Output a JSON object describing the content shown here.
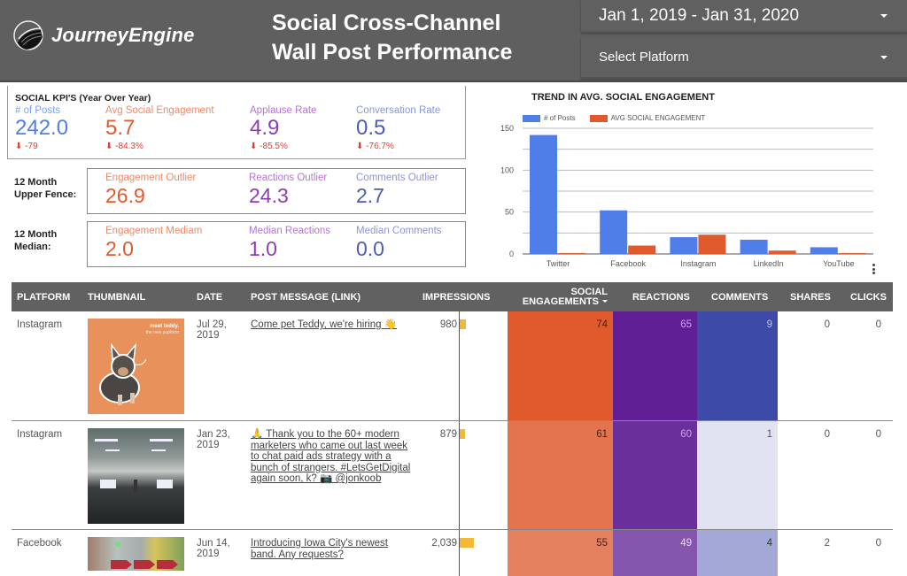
{
  "header": {
    "logo_text": "JourneyEngine",
    "title_line1": "Social Cross-Channel",
    "title_line2": "Wall Post Performance",
    "date_range": "Jan 1, 2019 - Jan 31, 2020",
    "platform_select": "Select Platform"
  },
  "kpis": {
    "heading": "SOCIAL KPI'S (Year Over Year)",
    "items": [
      {
        "label": "# of Posts",
        "value": "242.0",
        "delta": "-79"
      },
      {
        "label": "Avg Social Engagement",
        "value": "5.7",
        "delta": "-84.3%"
      },
      {
        "label": "Applause Rate",
        "value": "4.9",
        "delta": "-85.5%"
      },
      {
        "label": "Conversation Rate",
        "value": "0.5",
        "delta": "-76.7%"
      }
    ],
    "delta_icon": "arrow-down-icon"
  },
  "upper_fence": {
    "label_line1": "12 Month",
    "label_line2": "Upper Fence:",
    "items": [
      {
        "label": "Engagement Outlier",
        "value": "26.9"
      },
      {
        "label": "Reactions Outlier",
        "value": "24.3"
      },
      {
        "label": "Comments Outlier",
        "value": "2.7"
      }
    ]
  },
  "median": {
    "label_line1": "12 Month",
    "label_line2": "Median:",
    "items": [
      {
        "label": "Engagement Mediam",
        "value": "2.0"
      },
      {
        "label": "Median Reactions",
        "value": "1.0"
      },
      {
        "label": "Median Comments",
        "value": "0.0"
      }
    ]
  },
  "colors": {
    "posts_blue": "#4f7ee8",
    "engagement_orange": "#e05a2e",
    "header_gray": "#5f5f5f",
    "impressions_bar": "#f4b836"
  },
  "chart_data": {
    "type": "bar",
    "title": "TREND IN AVG. SOCIAL ENGAGEMENT",
    "categories": [
      "Twitter",
      "Facebook",
      "Instagram",
      "LinkedIn",
      "YouTube"
    ],
    "series": [
      {
        "name": "# of Posts",
        "color": "#4f7ee8",
        "values": [
          142,
          52,
          20,
          17,
          8
        ]
      },
      {
        "name": "AVG SOCIAL ENGAGEMENT",
        "color": "#e05a2e",
        "values": [
          1,
          10,
          23,
          4,
          1
        ]
      }
    ],
    "ylim": [
      0,
      150
    ],
    "yticks": [
      0,
      50,
      100,
      150
    ],
    "grid": true,
    "legend": "top-left",
    "xlabel": "",
    "ylabel": ""
  },
  "table": {
    "columns": [
      "PLATFORM",
      "THUMBNAIL",
      "DATE",
      "POST MESSAGE (LINK)",
      "IMPRESSIONS",
      "SOCIAL",
      "ENGAGEMENTS",
      "REACTIONS",
      "COMMENTS",
      "SHARES",
      "CLICKS"
    ],
    "sort_column": "SOCIAL ENGAGEMENTS",
    "rows": [
      {
        "platform": "Instagram",
        "thumb_caption1": "meet teddy.",
        "thumb_caption2": "the new pupform",
        "date_line1": "Jul 29,",
        "date_line2": "2019",
        "message": "Come pet Teddy, we're hiring 👋",
        "impressions": "980",
        "impressions_value": 980,
        "social_engagements": "74",
        "reactions": "65",
        "comments": "9",
        "shares": "0",
        "clicks": "0"
      },
      {
        "platform": "Instagram",
        "date_line1": "Jan 23,",
        "date_line2": "2019",
        "message": "🙏 Thank you to the 60+ modern marketers who came out last week to chat paid ads strategy with a bunch of strangers. #LetsGetDigital again soon, k? 📷 @jonkoob",
        "impressions": "879",
        "impressions_value": 879,
        "social_engagements": "61",
        "reactions": "60",
        "comments": "1",
        "shares": "0",
        "clicks": "0"
      },
      {
        "platform": "Facebook",
        "date_line1": "Jun 14,",
        "date_line2": "2019",
        "message": "Introducing Iowa City's newest band. Any requests?",
        "impressions": "2,039",
        "impressions_value": 2039,
        "social_engagements": "55",
        "reactions": "49",
        "comments": "4",
        "shares": "2",
        "clicks": "0"
      }
    ]
  }
}
